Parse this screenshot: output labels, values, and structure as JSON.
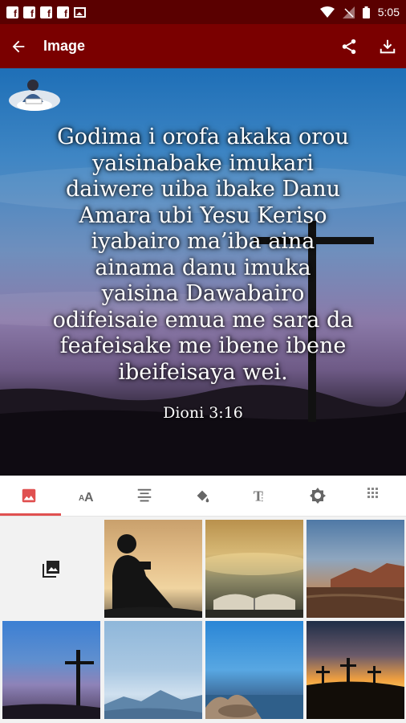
{
  "status_bar": {
    "notifications": [
      "facebook-icon",
      "facebook-icon",
      "facebook-icon",
      "facebook-icon",
      "image-icon"
    ],
    "time": "5:05"
  },
  "app_bar": {
    "title": "Image"
  },
  "verse": {
    "lines": [
      "Godima i orofa akaka orou",
      "yaisinabake imukari",
      "daiwere uiba ibake Danu",
      "Amara ubi Yesu Keriso",
      "iyabairo ma’iba aina",
      "ainama danu imuka",
      "yaisina Dawabairo",
      "odifeisaie emua me sara da",
      "feafeisake me ibene ibene",
      "ibeifeisaya wei."
    ],
    "reference": "Dioni 3:16"
  },
  "tabs": [
    {
      "icon": "image-icon",
      "active": true
    },
    {
      "icon": "text-size-icon",
      "active": false
    },
    {
      "icon": "align-icon",
      "active": false
    },
    {
      "icon": "paint-bucket-icon",
      "active": false
    },
    {
      "icon": "text-style-icon",
      "active": false
    },
    {
      "icon": "brightness-icon",
      "active": false
    },
    {
      "icon": "pattern-icon",
      "active": false
    }
  ],
  "thumbnails": [
    {
      "name": "add-image",
      "icon": "add-photo-icon"
    },
    {
      "name": "silhouette-reading"
    },
    {
      "name": "open-bible-sunset"
    },
    {
      "name": "desert-canyon"
    },
    {
      "name": "cross-dusk"
    },
    {
      "name": "blue-mountains"
    },
    {
      "name": "rocky-shore"
    },
    {
      "name": "three-crosses-sunset"
    }
  ],
  "colors": {
    "status_bar": "#5a0000",
    "app_bar": "#7a0000",
    "accent": "#e05050"
  }
}
